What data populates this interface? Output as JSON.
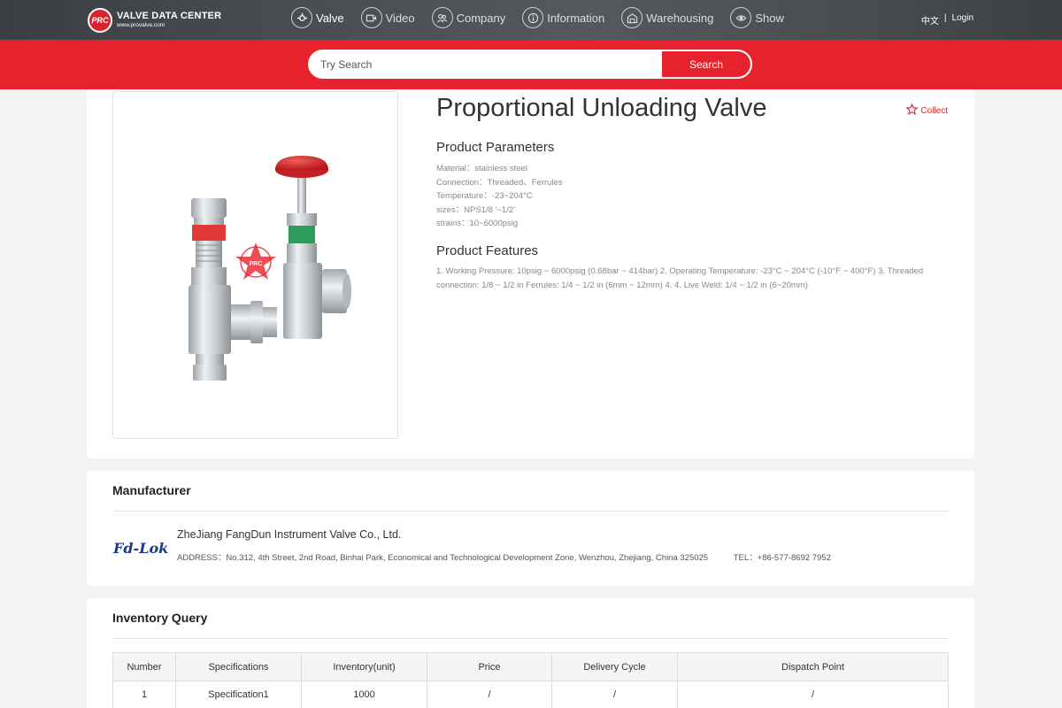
{
  "header": {
    "logo_badge": "PRC",
    "logo_title": "VALVE DATA CENTER",
    "logo_url": "www.provalve.com",
    "nav": [
      {
        "label": "Valve",
        "icon": "valve-icon"
      },
      {
        "label": "Video",
        "icon": "video-icon"
      },
      {
        "label": "Company",
        "icon": "company-icon"
      },
      {
        "label": "Information",
        "icon": "information-icon"
      },
      {
        "label": "Warehousing",
        "icon": "warehouse-icon"
      },
      {
        "label": "Show",
        "icon": "show-icon"
      }
    ],
    "lang": "中文",
    "separator": "|",
    "login": "Login"
  },
  "search": {
    "placeholder": "Try Search",
    "button": "Search"
  },
  "product": {
    "title": "Proportional Unloading Valve",
    "collect": "Collect",
    "params_heading": "Product Parameters",
    "params": [
      "Material：stainless steel",
      "Connection：Threaded、Ferrules",
      "Temperature：-23~204°C",
      "sizes：NPS1/8 '~1/2'",
      "strains：10~6000psig"
    ],
    "features_heading": "Product Features",
    "features": "1. Working Pressure: 10psig ~ 6000psig (0.68bar ~ 414bar) 2. Operating Temperature: -23°C ~ 204°C (-10°F ~ 400°F) 3. Threaded connection: 1/8 ~ 1/2 in     Ferrules: 1/4 ~ 1/2 in (6mm ~ 12mm) 4. 4. Live Weld: 1/4 ~ 1/2 in (6~20mm)",
    "image_watermark": "PRC"
  },
  "manufacturer": {
    "heading": "Manufacturer",
    "logo_text": "Fd-Lok",
    "name": "ZheJiang FangDun Instrument Valve Co., Ltd.",
    "address": "ADDRESS：No.312, 4th Street, 2nd Road, Binhai Park, Economical and Technological Development Zone, Wenzhou, Zhejiang, China 325025",
    "tel": "TEL：+86-577-8692 7952"
  },
  "inventory": {
    "heading": "Inventory Query",
    "columns": [
      "Number",
      "Specifications",
      "Inventory(unit)",
      "Price",
      "Delivery Cycle",
      "Dispatch Point"
    ],
    "rows": [
      [
        "1",
        "Specification1",
        "1000",
        "/",
        "/",
        "/"
      ]
    ]
  },
  "colors": {
    "brand_red": "#e8222c",
    "nav_bg": "#4a4e52"
  }
}
